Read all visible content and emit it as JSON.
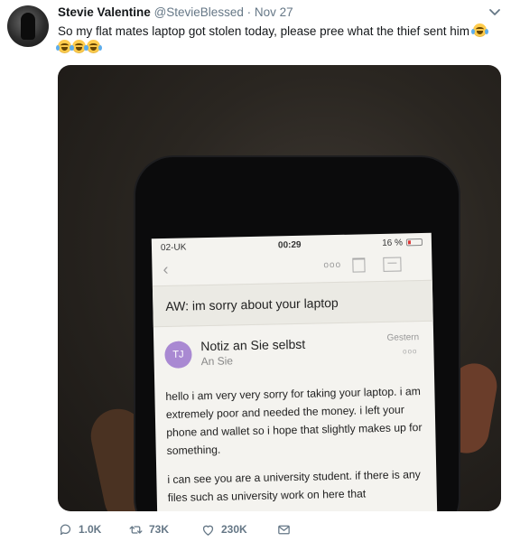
{
  "tweet": {
    "name": "Stevie Valentine",
    "handle": "@StevieBlessed",
    "separator": "·",
    "date": "Nov 27",
    "text": "So my flat mates laptop got stolen today, please pree what the thief sent him",
    "emoji": "face-with-tears-of-joy"
  },
  "screenshot": {
    "status": {
      "carrier": "02-UK",
      "time": "00:29",
      "battery": "16 %"
    },
    "toolbar": {
      "more": "ooo"
    },
    "subject": "AW: im sorry about your laptop",
    "sender": {
      "initials": "TJ",
      "from": "Notiz an Sie selbst",
      "to": "An Sie",
      "when": "Gestern",
      "dots": "ooo"
    },
    "body": [
      "hello i am very very sorry for taking your laptop. i am extremely poor and needed the money. i left your phone and wallet so i hope that slightly makes up for something.",
      "i can see you are a university student. if there is any files such as university work on here that"
    ]
  },
  "actions": {
    "reply": "1.0K",
    "retweet": "73K",
    "like": "230K"
  },
  "colors": {
    "secondary": "#657786",
    "badge": "#a989d2"
  }
}
